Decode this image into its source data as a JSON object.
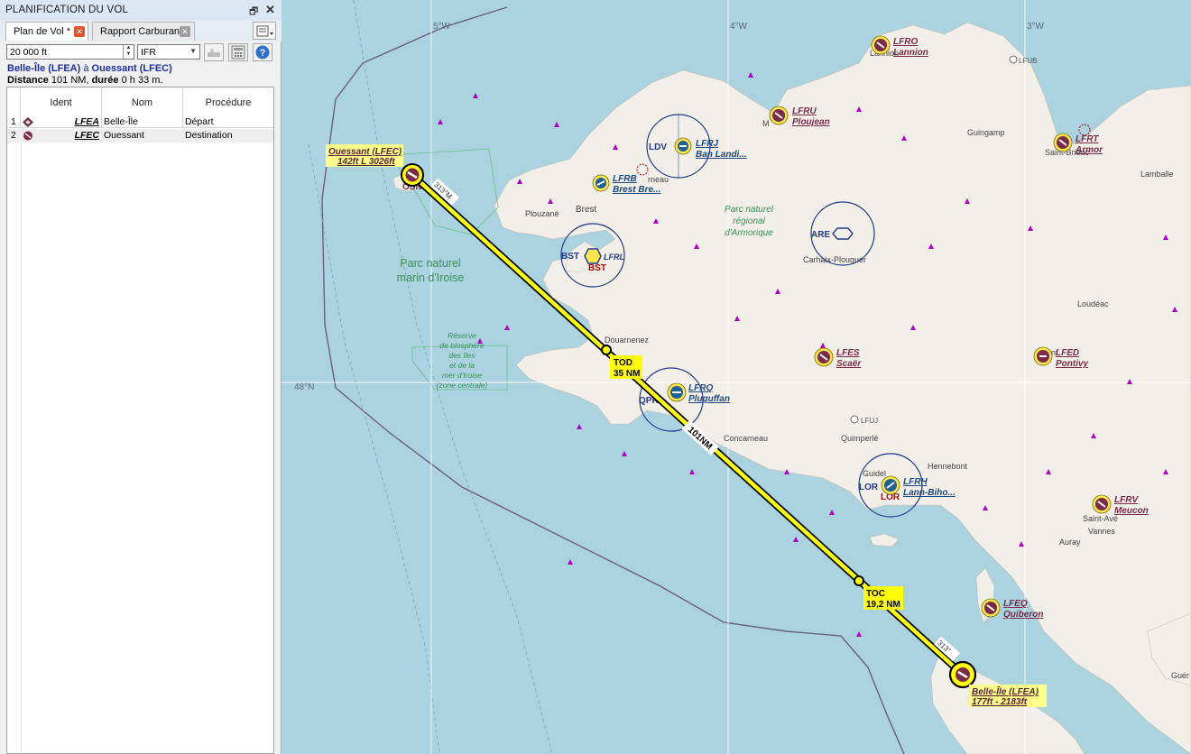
{
  "panel": {
    "title": "PLANIFICATION DU VOL",
    "pin_glyph": "🗗",
    "close_glyph": "✕",
    "tabs": [
      {
        "label": "Plan de Vol *",
        "close": "✕"
      },
      {
        "label": "Rapport Carburant",
        "close": "✕"
      }
    ],
    "altitude": "20 000 ft",
    "flight_rules": "IFR",
    "route_title": {
      "from": "Belle-Île (LFEA)",
      "conj": "à",
      "to": "Ouessant (LFEC)"
    },
    "distance_line": {
      "label_distance": "Distance",
      "distance": "101 NM",
      "sep": ",",
      "label_duree": "durée",
      "duree": "0 h 33 m."
    },
    "columns": [
      "Ident",
      "Nom",
      "Procédure"
    ],
    "rows": [
      {
        "num": "1",
        "ident": "LFEA",
        "name": "Belle-Île",
        "procedure": "Départ"
      },
      {
        "num": "2",
        "ident": "LFEC",
        "name": "Ouessant",
        "procedure": "Destination"
      }
    ],
    "help_glyph": "?"
  },
  "map": {
    "colors": {
      "sea": "#aad3df",
      "land": "#f2efe9",
      "route": "#ffff00",
      "airport_ring": "#ffe64a",
      "airport_body": "#7a2a4a",
      "vor": "#223a8a"
    },
    "graticule": {
      "lon1": "5°W",
      "lon2": "4°W",
      "lon3": "3°W",
      "lat": "48°N"
    },
    "park_iroise": {
      "line1": "Parc naturel",
      "line2": "marin d'Iroise"
    },
    "reserve": {
      "l1": "Réserve",
      "l2": "de biosphère",
      "l3": "des îles",
      "l4": "et de la",
      "l5": "mer d'Iroise",
      "l6": "(zone centrale)"
    },
    "park_armorique": {
      "l1": "Parc naturel",
      "l2": "régional",
      "l3": "d'Armorique"
    },
    "towns": {
      "brest": "Brest",
      "plouzane": "Plouzané",
      "douarnenez": "Douarnenez",
      "concarneau": "Concarneau",
      "quimperle": "Quimperlé",
      "guingamp": "Guingamp",
      "lamballe": "Lamballe",
      "loudeac": "Loudéac",
      "carhaix": "Carhaix-Plouguer",
      "auray": "Auray",
      "vannes": "Vannes",
      "stave": "Saint-Avé",
      "hennebont": "Hennebont",
      "stbrieuc": "Saint-Brieuc",
      "guidel": "Guidel",
      "pont": "Pont",
      "guer": "Guér",
      "lannion": "Lannion",
      "morlaix": "M",
      "landerneau": "rneau"
    },
    "route": {
      "tod_label": "TOD",
      "tod_dist": "35 NM",
      "toc_label": "TOC",
      "toc_dist": "19,2 NM",
      "total": "101NM",
      "heading1": "313°M",
      "heading2": "313°"
    },
    "dep_label": {
      "name": "Belle-Île (LFEA)",
      "info": "177ft - 2183ft"
    },
    "dest_label": {
      "name": "Ouessant (LFEC)",
      "info": "142ft L 3026ft"
    },
    "airports": [
      {
        "code": "LFRO",
        "name": "Lannion"
      },
      {
        "code": "LFRU",
        "name": "Ploujean"
      },
      {
        "code": "LFRT",
        "name": "Armor"
      },
      {
        "code": "LFRJ",
        "name": "Ban Landi..."
      },
      {
        "code": "LFRB",
        "name": "Brest Bre..."
      },
      {
        "code": "LFRQ",
        "name": "Pluguffan"
      },
      {
        "code": "LFES",
        "name": "Scaër"
      },
      {
        "code": "LFED",
        "name": "Pontivy"
      },
      {
        "code": "LFRH",
        "name": "Lann-Biho..."
      },
      {
        "code": "LFRV",
        "name": "Meucon"
      },
      {
        "code": "LFEQ",
        "name": "Quiberon"
      }
    ],
    "vors": {
      "ldv": "LDV",
      "are": "ARE",
      "bst": "BST",
      "bst2": "BST",
      "lfrl": "LFRL",
      "qpr": "QPR",
      "lor": "LOR",
      "lor2": "LOR",
      "osn": "OSN"
    },
    "small_fields": {
      "lfub": "LFUB",
      "lfuj": "LFUJ"
    }
  }
}
